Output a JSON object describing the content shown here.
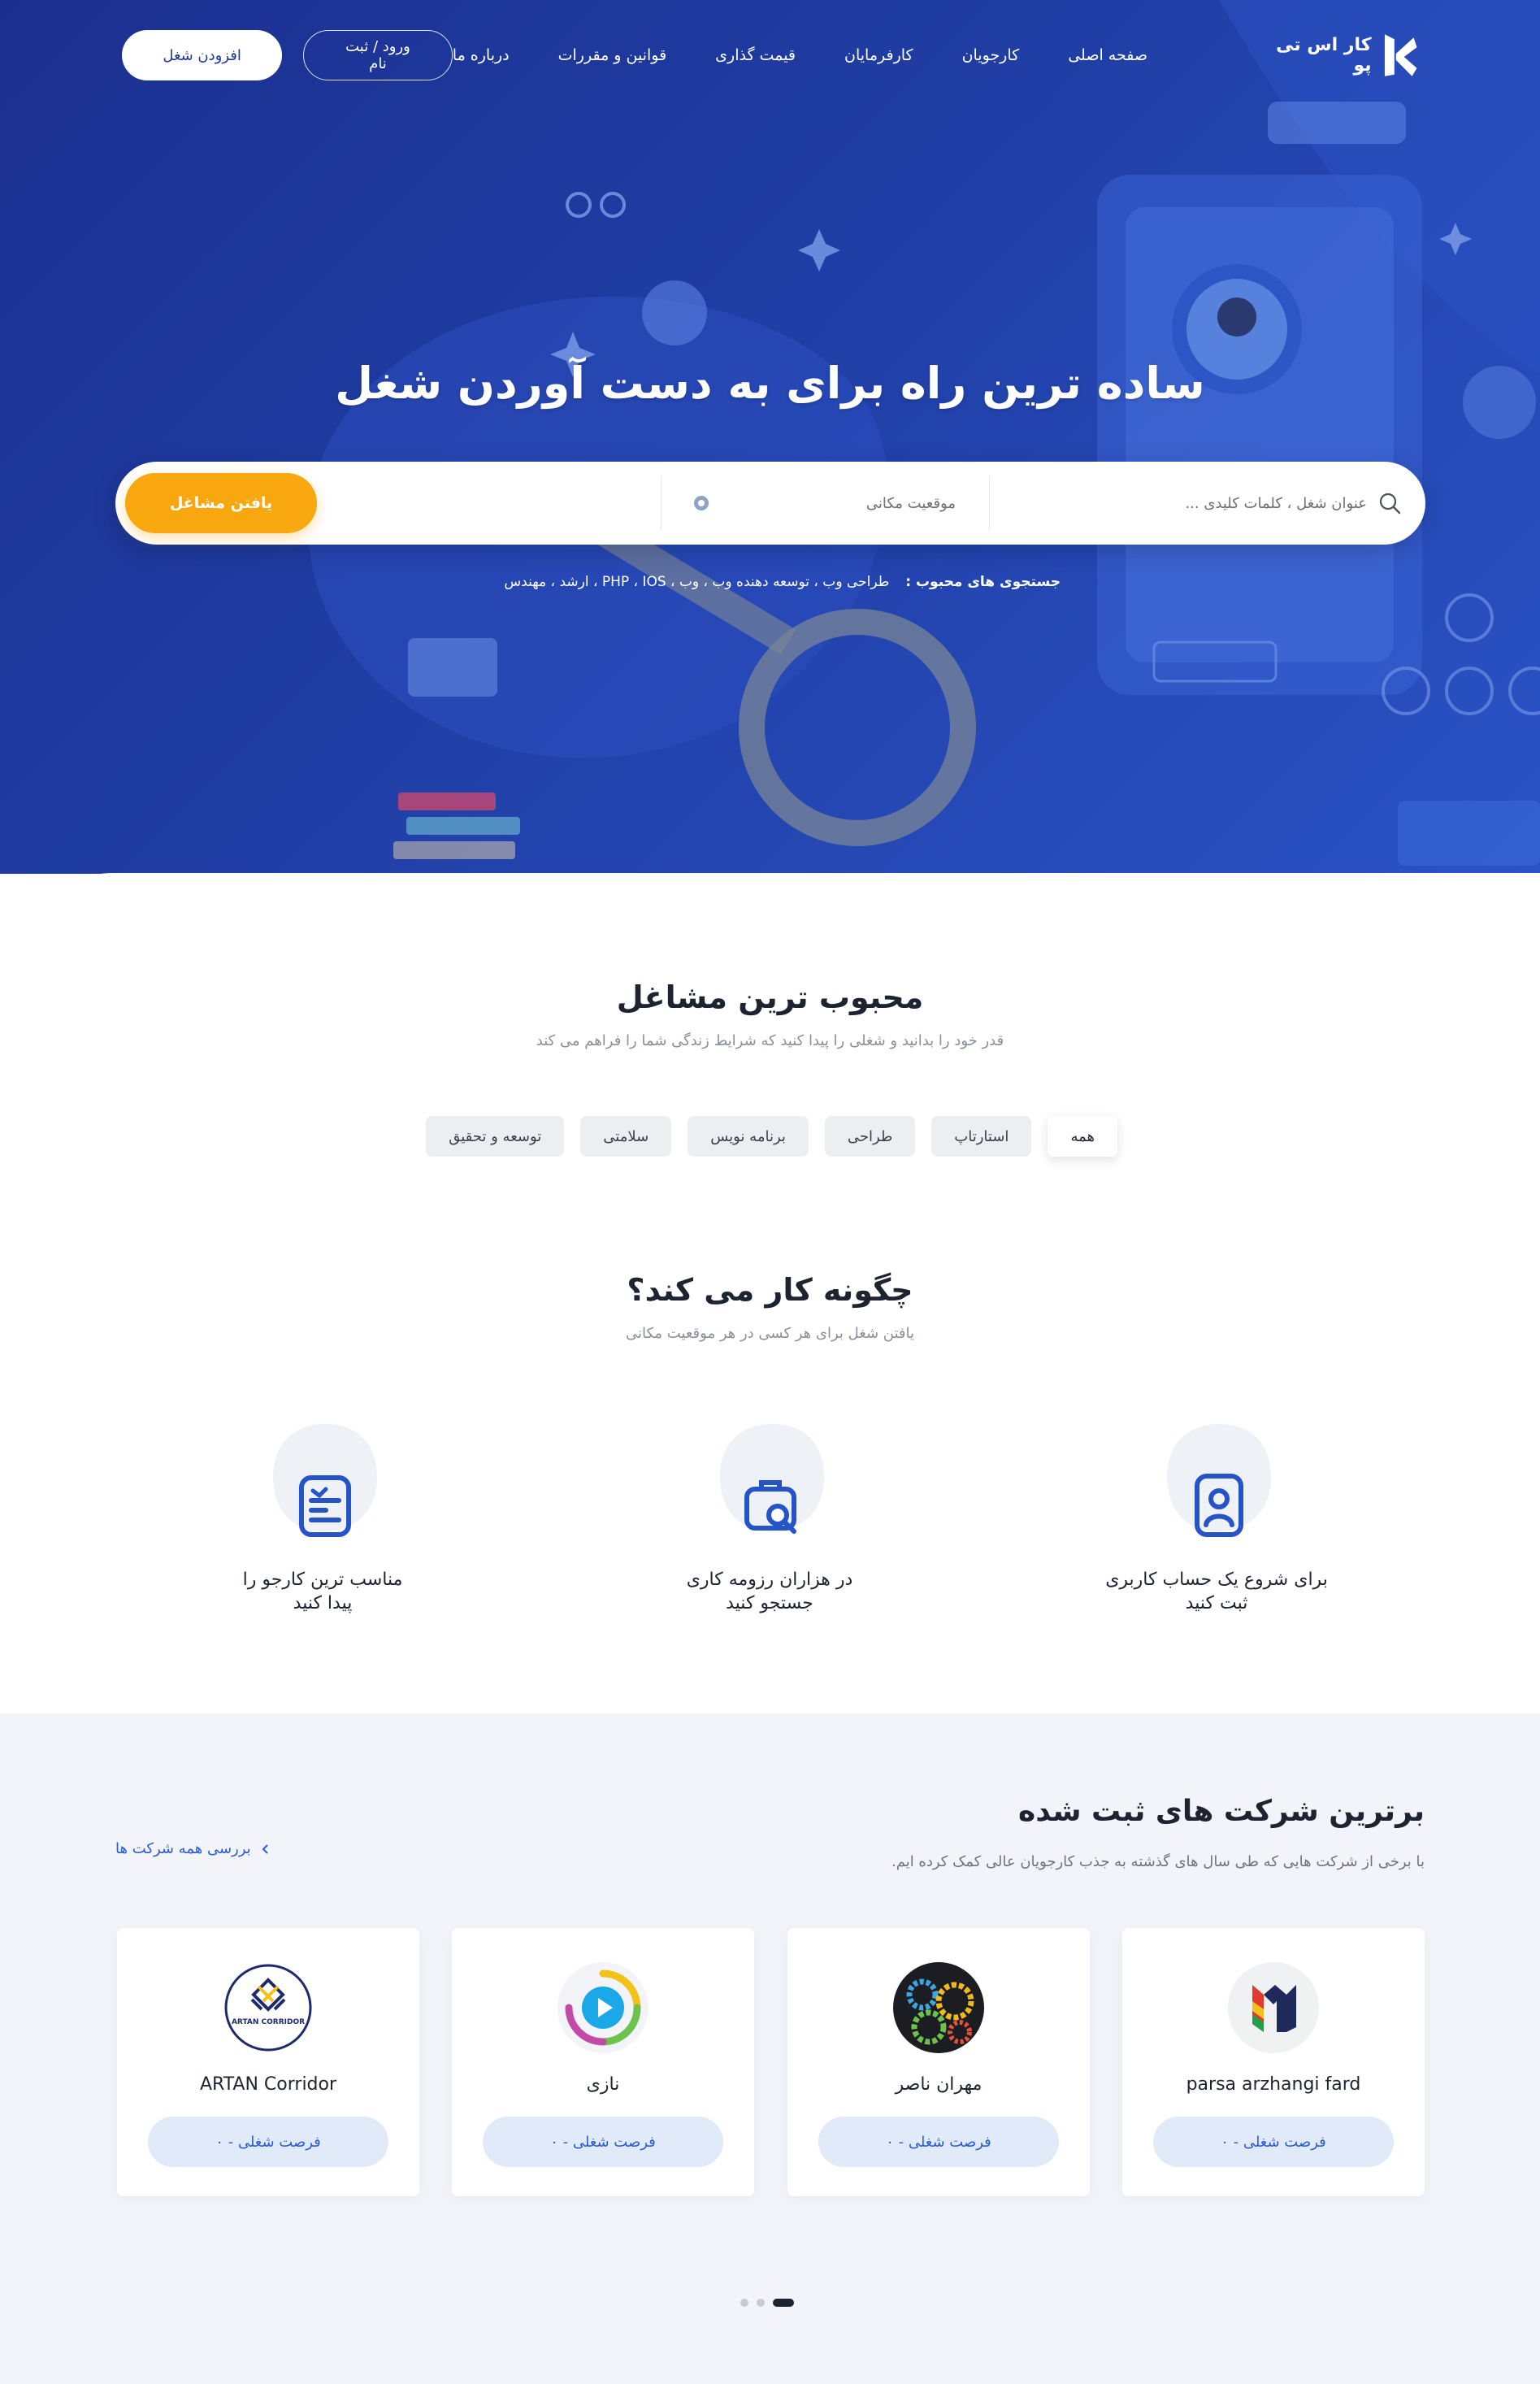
{
  "nav": {
    "brand": "کار اس تی پو",
    "links": [
      "صفحه اصلی",
      "کارجویان",
      "کارفرمایان",
      "قیمت گذاری",
      "قوانین و مقررات",
      "درباره ما"
    ],
    "login_label": "ورود / ثبت نام",
    "add_job_label": "افزودن شغل"
  },
  "hero": {
    "title": "ساده ترین راه برای به دست آوردن شغل",
    "search_placeholder": "عنوان شغل ، کلمات کلیدی ...",
    "location_placeholder": "موقعیت مکانی",
    "find_button": "یافتن مشاغل",
    "popular_label": "جستجوی های محبوب :",
    "popular_terms": "طراحی وب ، توسعه دهنده وب ، وب ، PHP ، IOS ، ارشد ، مهندس"
  },
  "popular_jobs": {
    "title": "محبوب ترین مشاغل",
    "subtitle": "قدر خود را بدانید و شغلی را پیدا کنید که شرایط زندگی شما را فراهم می کند",
    "categories": [
      "همه",
      "استارتاپ",
      "طراحی",
      "برنامه نویس",
      "سلامتی",
      "توسعه و تحقیق"
    ]
  },
  "how_it_works": {
    "title": "چگونه کار می کند؟",
    "subtitle": "یافتن شغل برای هر کسی در هر موقعیت مکانی",
    "steps": [
      {
        "line1": "برای شروع یک حساب کاربری",
        "line2": "ثبت کنید",
        "icon": "user-badge-icon"
      },
      {
        "line1": "در هزاران رزومه کاری",
        "line2": "جستجو کنید",
        "icon": "briefcase-search-icon"
      },
      {
        "line1": "مناسب ترین کارجو را",
        "line2": "پیدا کنید",
        "icon": "clipboard-icon"
      }
    ]
  },
  "companies": {
    "title": "برترین شرکت های ثبت شده",
    "subtitle": "با برخی از شرکت هایی که طی سال های گذشته به جذب کارجویان عالی کمک کرده ایم.",
    "view_all": "بررسی همه شرکت ها",
    "items": [
      {
        "name": "parsa arzhangi fard",
        "jobs": "فرصت شغلی - ۰"
      },
      {
        "name": "مهران ناصر",
        "jobs": "فرصت شغلی - ۰"
      },
      {
        "name": "نازی",
        "jobs": "فرصت شغلی - ۰"
      },
      {
        "name": "ARTAN Corridor",
        "jobs": "فرصت شغلی - ۰"
      }
    ],
    "artan_logo_text": "ARTAN CORRIDOR"
  },
  "colors": {
    "hero_blue": "#203ea5",
    "accent_orange": "#f8a70e",
    "link_blue": "#2a5bd7"
  }
}
